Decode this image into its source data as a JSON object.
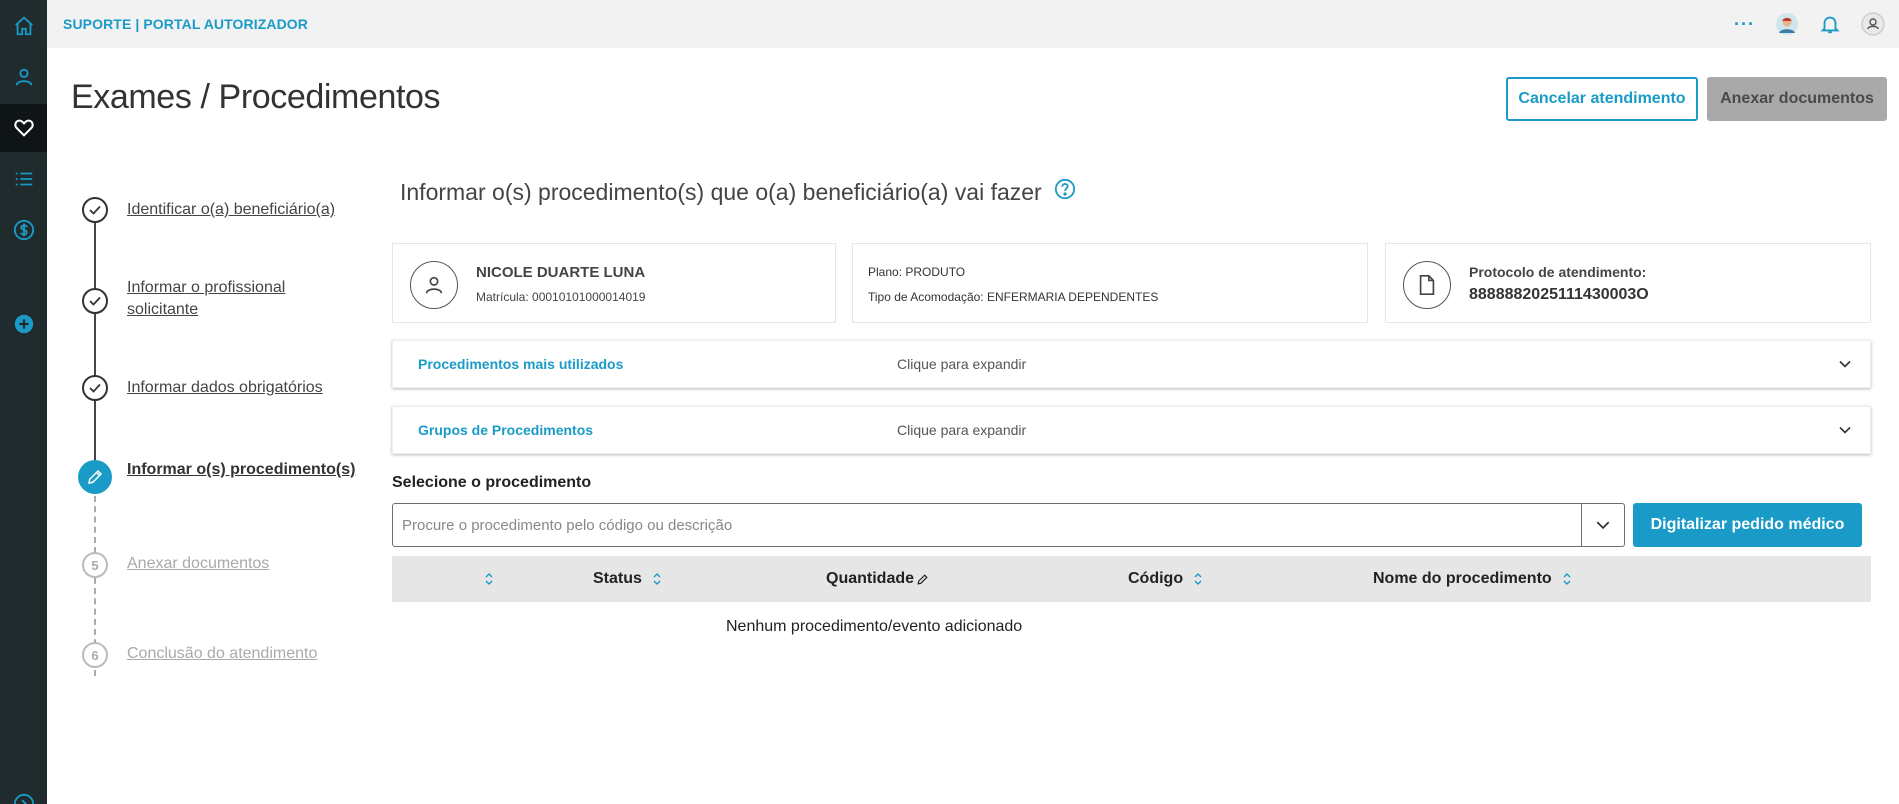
{
  "topbar": {
    "app_title": "SUPORTE | PORTAL AUTORIZADOR",
    "more_label": "···"
  },
  "rail": {
    "items": [
      "home-icon",
      "user-icon",
      "heart-icon",
      "list-icon",
      "dollar-icon",
      "plus-circle-icon"
    ],
    "active": "heart-icon"
  },
  "page": {
    "title": "Exames / Procedimentos",
    "cancel_label": "Cancelar atendimento",
    "attach_label": "Anexar documentos"
  },
  "stepper": {
    "steps": [
      {
        "label": "Identificar o(a) beneficiário(a)",
        "state": "done"
      },
      {
        "label": "Informar o profissional solicitante",
        "state": "done"
      },
      {
        "label": "Informar dados obrigatórios",
        "state": "done"
      },
      {
        "label": "Informar o(s) procedimento(s)",
        "state": "current"
      },
      {
        "label": "Anexar documentos",
        "state": "todo",
        "number": "5"
      },
      {
        "label": "Conclusão do atendimento",
        "state": "todo",
        "number": "6"
      }
    ]
  },
  "main": {
    "section_title": "Informar o(s) procedimento(s) que o(a) beneficiário(a) vai fazer",
    "beneficiary": {
      "name": "NICOLE DUARTE LUNA",
      "matricula": "Matrícula: 00010101000014019"
    },
    "plan": {
      "plano": "Plano: PRODUTO",
      "acomodacao": "Tipo de Acomodação: ENFERMARIA DEPENDENTES"
    },
    "protocol": {
      "label": "Protocolo de atendimento:",
      "value": "8888882025111430003O"
    },
    "accordions": [
      {
        "title": "Procedimentos mais utilizados",
        "hint": "Clique para expandir"
      },
      {
        "title": "Grupos de Procedimentos",
        "hint": "Clique para expandir"
      }
    ],
    "select_label": "Selecione o procedimento",
    "search_placeholder": "Procure o procedimento pelo código ou descrição",
    "digitize_label": "Digitalizar pedido médico",
    "table": {
      "columns": [
        "",
        "Status",
        "Quantidade",
        "Código",
        "Nome do procedimento"
      ],
      "empty_message": "Nenhum procedimento/evento adicionado"
    }
  },
  "colors": {
    "accent": "#1a9bc7",
    "rail": "#1f2b2d",
    "disabled_button": "#a9a9a9"
  }
}
